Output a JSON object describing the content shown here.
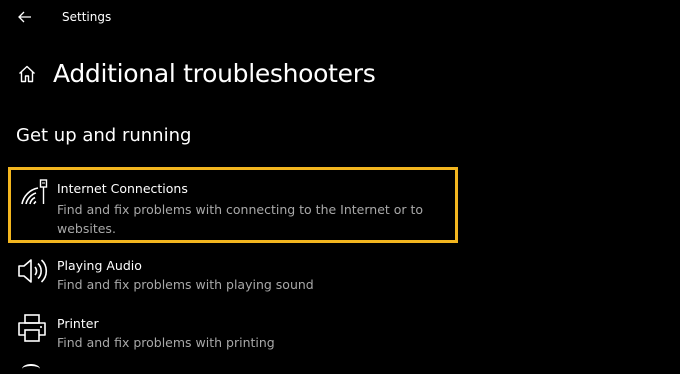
{
  "window": {
    "title": "Settings"
  },
  "header": {
    "title": "Additional troubleshooters"
  },
  "section": {
    "title": "Get up and running"
  },
  "items": [
    {
      "name": "Internet Connections",
      "description": "Find and fix problems with connecting to the Internet or to websites.",
      "icon": "wifi-network-icon",
      "selected": true
    },
    {
      "name": "Playing Audio",
      "description": "Find and fix problems with playing sound",
      "icon": "speaker-icon"
    },
    {
      "name": "Printer",
      "description": "Find and fix problems with printing",
      "icon": "printer-icon"
    }
  ],
  "colors": {
    "background": "#000000",
    "text": "#ffffff",
    "secondary_text": "#a8a8a8",
    "highlight": "#f3b61f"
  }
}
